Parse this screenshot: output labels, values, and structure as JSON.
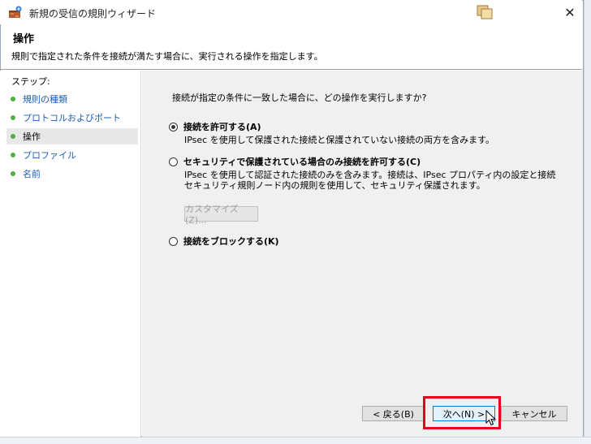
{
  "window": {
    "title": "新規の受信の規則ウィザード",
    "close_glyph": "✕"
  },
  "header": {
    "title": "操作",
    "description": "規則で指定された条件を接続が満たす場合に、実行される操作を指定します。"
  },
  "steps": {
    "label": "ステップ:",
    "items": [
      {
        "label": "規則の種類",
        "active": false
      },
      {
        "label": "プロトコルおよびポート",
        "active": false
      },
      {
        "label": "操作",
        "active": true
      },
      {
        "label": "プロファイル",
        "active": false
      },
      {
        "label": "名前",
        "active": false
      }
    ]
  },
  "content": {
    "question": "接続が指定の条件に一致した場合に、どの操作を実行しますか?",
    "options": [
      {
        "label": "接続を許可する(A)",
        "checked": true,
        "desc": [
          "IPsec を使用して保護された接続と保護されていない接続の両方を含みます。"
        ]
      },
      {
        "label": "セキュリティで保護されている場合のみ接続を許可する(C)",
        "checked": false,
        "desc": [
          "IPsec を使用して認証された接続のみを含みます。接続は、IPsec プロパティ内の設定と接続",
          "セキュリティ規則ノード内の規則を使用して、セキュリティ保護されます。"
        ]
      },
      {
        "label": "接続をブロックする(K)",
        "checked": false,
        "desc": []
      }
    ],
    "customize_label": "カスタマイズ(Z)..."
  },
  "buttons": {
    "back_label": "< 戻る(B)",
    "next_label": "次へ(N) >",
    "cancel_label": "キャンセル"
  },
  "colors": {
    "highlight": "#e8001c",
    "step_dot": "#52b043",
    "step_link": "#1a5fb4",
    "accent": "#0078d7"
  },
  "icons": {
    "app": "firewall-icon",
    "help": "help-icon",
    "close": "close-icon"
  }
}
